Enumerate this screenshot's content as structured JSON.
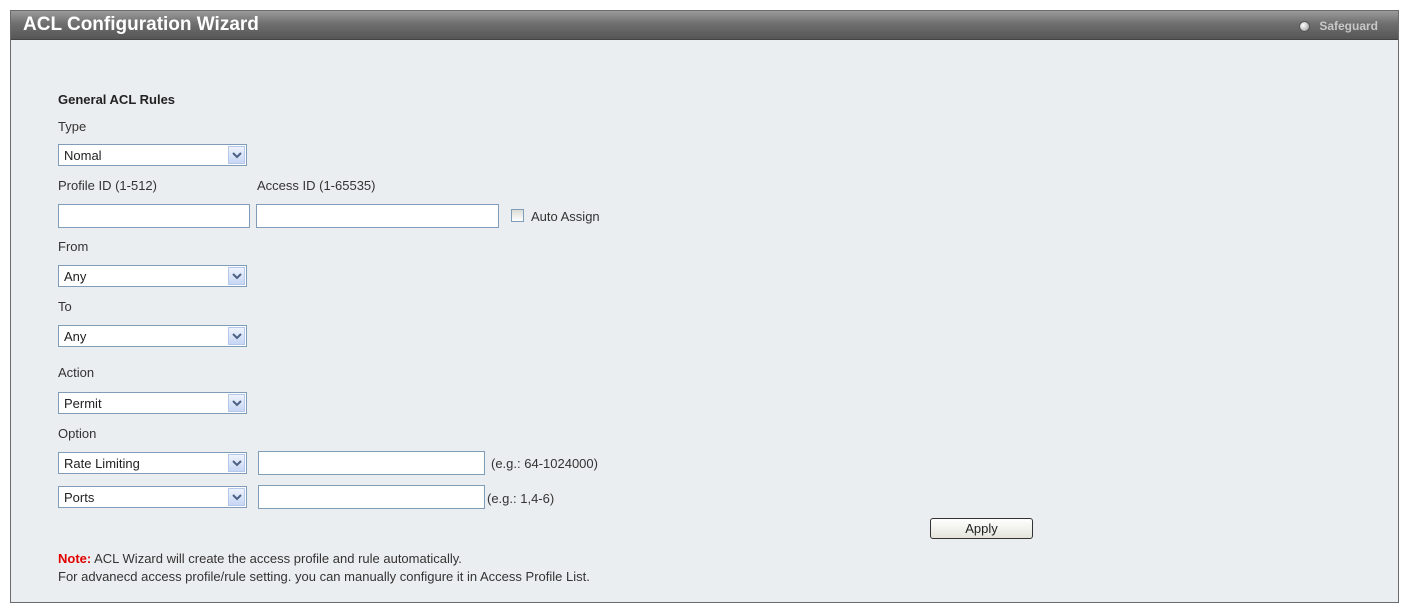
{
  "header": {
    "title": "ACL Configuration Wizard",
    "safeguard_label": "Safeguard"
  },
  "form": {
    "section_title": "General ACL Rules",
    "type": {
      "label": "Type",
      "selected": "Nomal"
    },
    "profile_id": {
      "label": "Profile ID (1-512)",
      "value": ""
    },
    "access_id": {
      "label": "Access ID (1-65535)",
      "value": ""
    },
    "auto_assign": {
      "label": "Auto Assign",
      "checked": false
    },
    "from": {
      "label": "From",
      "selected": "Any"
    },
    "to": {
      "label": "To",
      "selected": "Any"
    },
    "action": {
      "label": "Action",
      "selected": "Permit"
    },
    "option": {
      "label": "Option",
      "rate_limiting": {
        "selected": "Rate Limiting",
        "value": "",
        "hint": "(e.g.: 64-1024000)"
      },
      "ports": {
        "selected": "Ports",
        "value": "",
        "hint": "(e.g.: 1,4-6)"
      }
    },
    "apply_label": "Apply"
  },
  "note": {
    "prefix": "Note:",
    "line1": " ACL Wizard will create the access profile and rule automatically.",
    "line2": "For advanecd access profile/rule setting. you can manually configure it in Access Profile List."
  },
  "colors": {
    "note_prefix": "#e00000",
    "panel_bg": "#ebeef0",
    "titlebar": "#6f6f6f"
  }
}
